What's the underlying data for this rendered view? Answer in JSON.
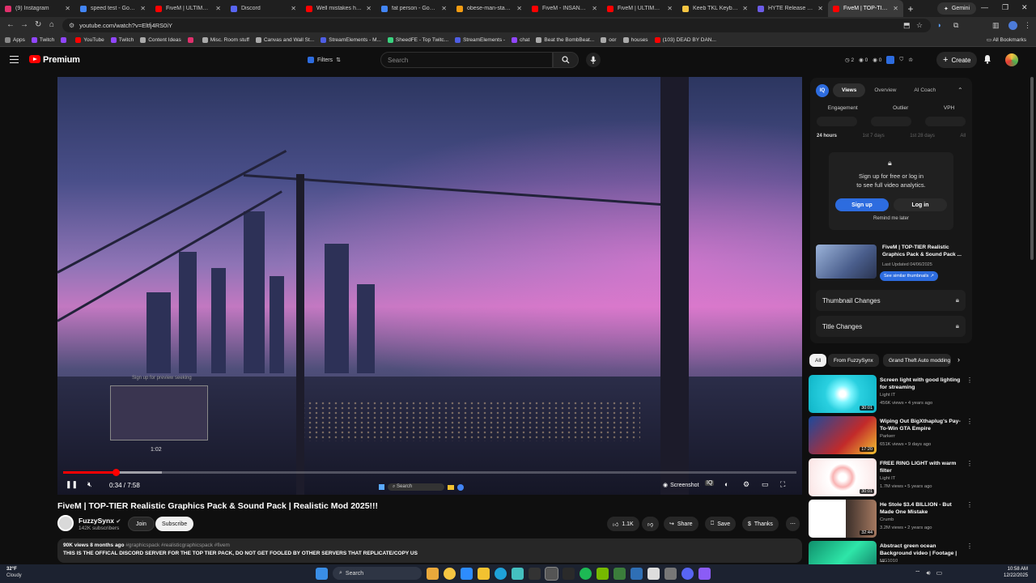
{
  "browser": {
    "tabs": [
      {
        "label": "(9) Instagram",
        "color": "#e1306c"
      },
      {
        "label": "speed test - Google S",
        "color": "#4285f4"
      },
      {
        "label": "FiveM | ULTIMATE Re",
        "color": "#ff0000"
      },
      {
        "label": "Discord",
        "color": "#5865f2"
      },
      {
        "label": "Well mistakes happe",
        "color": "#ff0000"
      },
      {
        "label": "fat person - Google S",
        "color": "#4285f4"
      },
      {
        "label": "obese-man-standing",
        "color": "#f39c12"
      },
      {
        "label": "FiveM - INSANE Reali",
        "color": "#ff0000"
      },
      {
        "label": "FiveM | ULTIMATE Re",
        "color": "#ff0000"
      },
      {
        "label": "Keeb TKL Keyboard",
        "color": "#f4c542"
      },
      {
        "label": "HYTE Release First K",
        "color": "#6c5ce7"
      },
      {
        "label": "FiveM | TOP-TIER Re",
        "color": "#ff0000",
        "active": true
      }
    ],
    "gemini_label": "Gemini",
    "url": "youtube.com/watch?v=Eltfj4RS0iY",
    "bookmarks": [
      {
        "label": "Apps",
        "color": "#888"
      },
      {
        "label": "Twitch",
        "color": "#9146ff"
      },
      {
        "label": "",
        "color": "#9146ff"
      },
      {
        "label": "YouTube",
        "color": "#ff0000"
      },
      {
        "label": "Twitch",
        "color": "#9146ff"
      },
      {
        "label": "Content Ideas",
        "color": "#aaa"
      },
      {
        "label": "",
        "color": "#e1306c"
      },
      {
        "label": "Misc. Room stuff",
        "color": "#aaa"
      },
      {
        "label": "Canvas and Wall St...",
        "color": "#aaa"
      },
      {
        "label": "StreamElements - M...",
        "color": "#4e5ee4"
      },
      {
        "label": "SheedFE - Top Twitc...",
        "color": "#3ad37f"
      },
      {
        "label": "StreamElements -",
        "color": "#4e5ee4"
      },
      {
        "label": "chat",
        "color": "#9146ff"
      },
      {
        "label": "Beat the BombBeat...",
        "color": "#aaa"
      },
      {
        "label": "oor",
        "color": "#aaa"
      },
      {
        "label": "houses",
        "color": "#aaa"
      },
      {
        "label": "(103) DEAD BY DAN...",
        "color": "#ff0000"
      }
    ],
    "all_bookmarks": "All Bookmarks"
  },
  "youtube": {
    "brand": "Premium",
    "filters": "Filters",
    "search_placeholder": "Search",
    "stats": [
      "2",
      "0",
      "0"
    ],
    "create": "Create"
  },
  "player": {
    "preview_hint": "Sign up for preview seeking",
    "preview_time": "1:02",
    "current_time": "0:34 / 7:58",
    "progress": 0.072,
    "buffered": 0.135,
    "mini_search": "Search",
    "screenshot": "Screenshot"
  },
  "video": {
    "title": "FiveM | TOP-TIER Realistic Graphics Pack & Sound Pack | Realistic Mod 2025!!!",
    "channel": "FuzzySynx",
    "subs": "142K subscribers",
    "join": "Join",
    "subscribe": "Subscribe",
    "likes": "1.1K",
    "share": "Share",
    "save": "Save",
    "thanks": "Thanks",
    "desc_meta": "90K views  8 months ago",
    "desc_tags": "#graphicspack #realisticgraphicspack #fivem",
    "desc_line2": "THIS IS THE OFFICAL DISCORD SERVER FOR THE TOP TIER PACK, DO NOT GET FOOLED BY OTHER SERVERS THAT REPLICATE/COPY US"
  },
  "vidiq": {
    "logo": "IQ",
    "tabs": [
      "Views",
      "Overview",
      "AI Coach"
    ],
    "cols": [
      "Engagement",
      "Outlier",
      "VPH"
    ],
    "periods": [
      "24 hours",
      "1st 7 days",
      "1st 28 days",
      "All"
    ],
    "lock_msg_1": "Sign up for free or log in",
    "lock_msg_2": "to see full video analytics.",
    "signup": "Sign up",
    "login": "Log in",
    "remind": "Remind me later",
    "card_title": "FiveM | TOP-TIER Realistic Graphics Pack & Sound Pack ...",
    "card_updated": "Last Updated 04/06/2025",
    "similar": "See similar thumbnails",
    "thumb_changes": "Thumbnail Changes",
    "title_changes": "Title Changes"
  },
  "chips": [
    "All",
    "From FuzzySynx",
    "Grand Theft Auto modding"
  ],
  "recs": [
    {
      "title": "Screen light with good lighting for streaming",
      "channel": "Light IT",
      "meta": "456K views • 4 years ago",
      "duration": "30:01",
      "bg": "radial-gradient(circle at 50% 50%, #ffffff 8%, #7ff6ff 22%, #2ad0e0 45%, #0fb5c8 100%)"
    },
    {
      "title": "Wiping Out BigXthaplug's Pay-To-Win GTA Empire",
      "channel": "Parkerr",
      "meta": "651K views • 9 days ago",
      "duration": "17:20",
      "bg": "linear-gradient(135deg, #1a4a9e, #c22a2a 60%, #f2c230)"
    },
    {
      "title": "FREE RING LIGHT with warm filter",
      "channel": "Light IT",
      "meta": "1.7M views • 5 years ago",
      "duration": "30:01",
      "bg": "radial-gradient(circle at 50% 50%, #ffffff 10%, #f9b3b3 25%, #ffffff 35%, #fbe3e3 100%)"
    },
    {
      "title": "He Stole $3.4 BILLION - But Made One Mistake",
      "channel": "Crumb",
      "meta": "3.2M views • 2 years ago",
      "duration": "32:44",
      "bg": "linear-gradient(90deg, #ffffff 0%, #ffffff 55%, #3b2f2a 55%, #a57960 100%)"
    },
    {
      "title": "Abstract green ocean Background video | Footage | ...",
      "channel": "MG1010",
      "meta": "",
      "duration": "",
      "bg": "linear-gradient(135deg, #0f8f6b, #2ee6a8 50%, #0c6a5a)"
    }
  ],
  "taskbar": {
    "temp": "32°F",
    "weather": "Cloudy",
    "search": "Search",
    "time": "10:58 AM",
    "date": "12/22/2025"
  }
}
